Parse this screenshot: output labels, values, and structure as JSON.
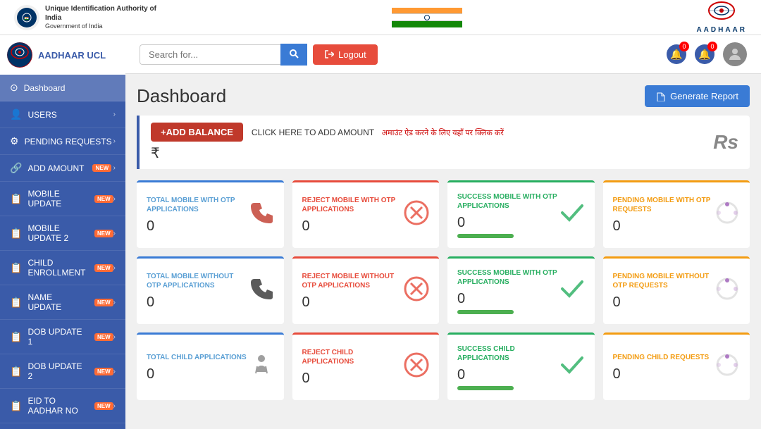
{
  "gov_header": {
    "org_name": "Unique Identification Authority of India",
    "org_sub": "Government of India",
    "center_logo_text": "AADHAAR"
  },
  "brand": {
    "name": "AADHAAR UCL"
  },
  "search": {
    "placeholder": "Search for..."
  },
  "header": {
    "logout_label": "Logout",
    "search_btn_label": "🔍",
    "notif1_count": "0",
    "notif2_count": "0"
  },
  "sidebar": {
    "items": [
      {
        "id": "dashboard",
        "label": "Dashboard",
        "icon": "⊙",
        "active": true,
        "badge": ""
      },
      {
        "id": "users",
        "label": "USERS",
        "icon": "👤",
        "active": false,
        "badge": ""
      },
      {
        "id": "pending",
        "label": "PENDING REQUESTS",
        "icon": "⚙",
        "active": false,
        "badge": ""
      },
      {
        "id": "add-amount",
        "label": "ADD AMOUNT",
        "icon": "🔗",
        "active": false,
        "badge": "NEW"
      },
      {
        "id": "mobile-update",
        "label": "MOBILE UPDATE",
        "icon": "📋",
        "active": false,
        "badge": "NEW"
      },
      {
        "id": "mobile-update-2",
        "label": "MOBILE UPDATE 2",
        "icon": "📋",
        "active": false,
        "badge": "NEW"
      },
      {
        "id": "child-enrollment",
        "label": "CHILD ENROLLMENT",
        "icon": "📋",
        "active": false,
        "badge": "NEW"
      },
      {
        "id": "name-update",
        "label": "NAME UPDATE",
        "icon": "📋",
        "active": false,
        "badge": "NEW"
      },
      {
        "id": "dob-update-1",
        "label": "DOB UPDATE 1",
        "icon": "📋",
        "active": false,
        "badge": "NEW"
      },
      {
        "id": "dob-update-2",
        "label": "DOB UPDATE 2",
        "icon": "📋",
        "active": false,
        "badge": "NEW"
      },
      {
        "id": "eid-to-aadhar",
        "label": "EID TO AADHAR NO",
        "icon": "📋",
        "active": false,
        "badge": "NEW"
      }
    ]
  },
  "dashboard": {
    "title": "Dashboard",
    "generate_report_label": "Generate Report"
  },
  "balance_banner": {
    "add_balance_label": "+ADD BALANCE",
    "click_text": "CLICK HERE TO ADD AMOUNT",
    "hindi_text": "अमाउंट ऐड करने के लिए यहाँ पर क्लिक करें",
    "rs_symbol": "Rs",
    "rupee_sign": "₹",
    "amount": ""
  },
  "stats_rows": [
    {
      "cards": [
        {
          "label": "TOTAL MOBILE WITH OTP APPLICATIONS",
          "value": "0",
          "icon": "phone",
          "border": "blue",
          "label_color": "blue"
        },
        {
          "label": "REJECT MOBILE WITH OTP APPLICATIONS",
          "value": "0",
          "icon": "x-circle",
          "border": "red",
          "label_color": "red"
        },
        {
          "label": "SUCCESS MOBILE WITH OTP APPLICATIONS",
          "value": "0",
          "icon": "check",
          "border": "green",
          "label_color": "green",
          "show_progress": true
        },
        {
          "label": "PENDING MOBILE WITH OTP REQUESTS",
          "value": "0",
          "icon": "spinner",
          "border": "yellow",
          "label_color": "yellow"
        }
      ]
    },
    {
      "cards": [
        {
          "label": "TOTAL MOBILE WITHOUT OTP APPLICATIONS",
          "value": "0",
          "icon": "phone-black",
          "border": "blue",
          "label_color": "blue"
        },
        {
          "label": "REJECT MOBILE WITHOUT OTP APPLICATIONS",
          "value": "0",
          "icon": "x-circle",
          "border": "red",
          "label_color": "red"
        },
        {
          "label": "SUCCESS MOBILE WITH OTP APPLICATIONS",
          "value": "0",
          "icon": "check",
          "border": "green",
          "label_color": "green",
          "show_progress": true
        },
        {
          "label": "PENDING MOBILE WITHOUT OTP REQUESTS",
          "value": "0",
          "icon": "spinner",
          "border": "yellow",
          "label_color": "yellow"
        }
      ]
    },
    {
      "cards": [
        {
          "label": "TOTAL CHILD APPLICATIONS",
          "value": "0",
          "icon": "child",
          "border": "blue",
          "label_color": "blue"
        },
        {
          "label": "REJECT CHILD APPLICATIONS",
          "value": "0",
          "icon": "x-circle",
          "border": "red",
          "label_color": "red"
        },
        {
          "label": "SUCCESS CHILD APPLICATIONS",
          "value": "0",
          "icon": "check",
          "border": "green",
          "label_color": "green",
          "show_progress": true
        },
        {
          "label": "PENDING CHILD REQUESTS",
          "value": "0",
          "icon": "spinner",
          "border": "yellow",
          "label_color": "yellow"
        }
      ]
    }
  ]
}
